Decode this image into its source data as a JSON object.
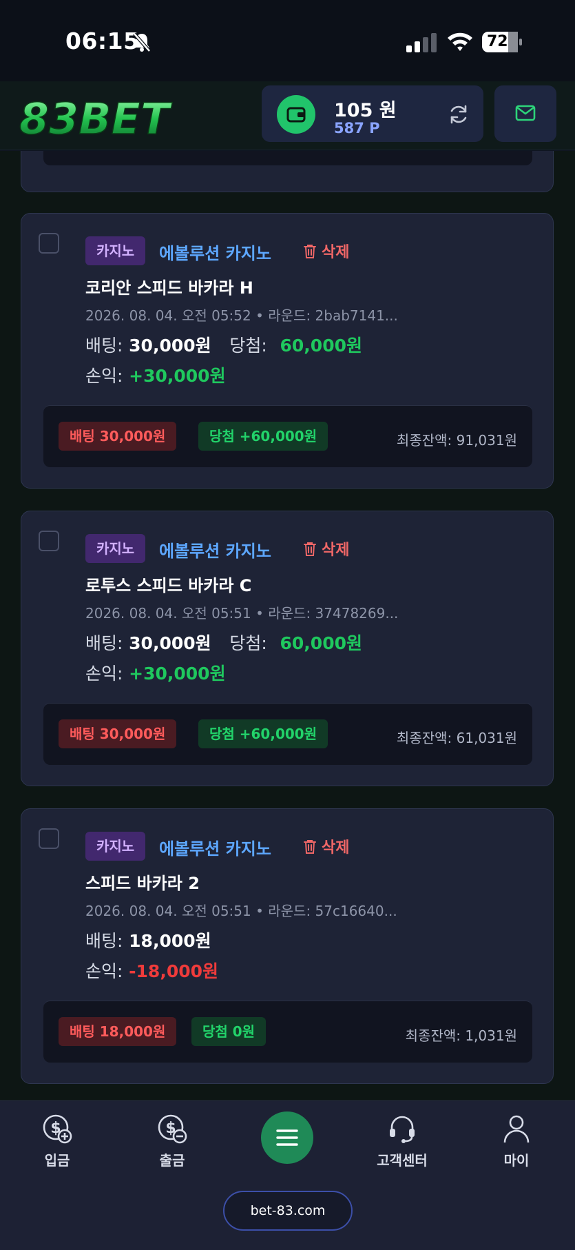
{
  "status_bar": {
    "time": "06:15",
    "battery": "72"
  },
  "header": {
    "logo_text": "83BET",
    "wallet": {
      "balance": "105 원",
      "points": "587 P"
    }
  },
  "bets": [
    {
      "category": "카지노",
      "provider": "에볼루션 카지노",
      "delete_label": "삭제",
      "game": "코리안 스피드 바카라 H",
      "meta": "2026. 08. 04. 오전 05:52 • 라운드: 2bab7141...",
      "bet_label": "배팅:",
      "bet_amount": "30,000원",
      "win_label": "당첨:",
      "win_amount": "60,000원",
      "pl_label": "손익:",
      "pl_amount": "+30,000원",
      "chip_bet": "배팅 30,000원",
      "chip_win": "당첨 +60,000원",
      "final_balance": "최종잔액: 91,031원"
    },
    {
      "category": "카지노",
      "provider": "에볼루션 카지노",
      "delete_label": "삭제",
      "game": "로투스 스피드 바카라 C",
      "meta": "2026. 08. 04. 오전 05:51 • 라운드: 37478269...",
      "bet_label": "배팅:",
      "bet_amount": "30,000원",
      "win_label": "당첨:",
      "win_amount": "60,000원",
      "pl_label": "손익:",
      "pl_amount": "+30,000원",
      "chip_bet": "배팅 30,000원",
      "chip_win": "당첨 +60,000원",
      "final_balance": "최종잔액: 61,031원"
    },
    {
      "category": "카지노",
      "provider": "에볼루션 카지노",
      "delete_label": "삭제",
      "game": "스피드 바카라 2",
      "meta": "2026. 08. 04. 오전 05:51 • 라운드: 57c16640...",
      "bet_label": "배팅:",
      "bet_amount": "18,000원",
      "pl_label": "손익:",
      "pl_amount": "-18,000원",
      "chip_bet": "배팅 18,000원",
      "chip_win": "당첨 0원",
      "final_balance": "최종잔액: 1,031원"
    }
  ],
  "nav": {
    "deposit": "입금",
    "withdraw": "출금",
    "support": "고객센터",
    "my": "마이"
  },
  "footer_url": "bet-83.com",
  "colors": {
    "accent_green": "#1fc85e",
    "loss_red": "#ef3b3b",
    "provider_blue": "#5da7ff",
    "casino_tag": "#42286e"
  }
}
